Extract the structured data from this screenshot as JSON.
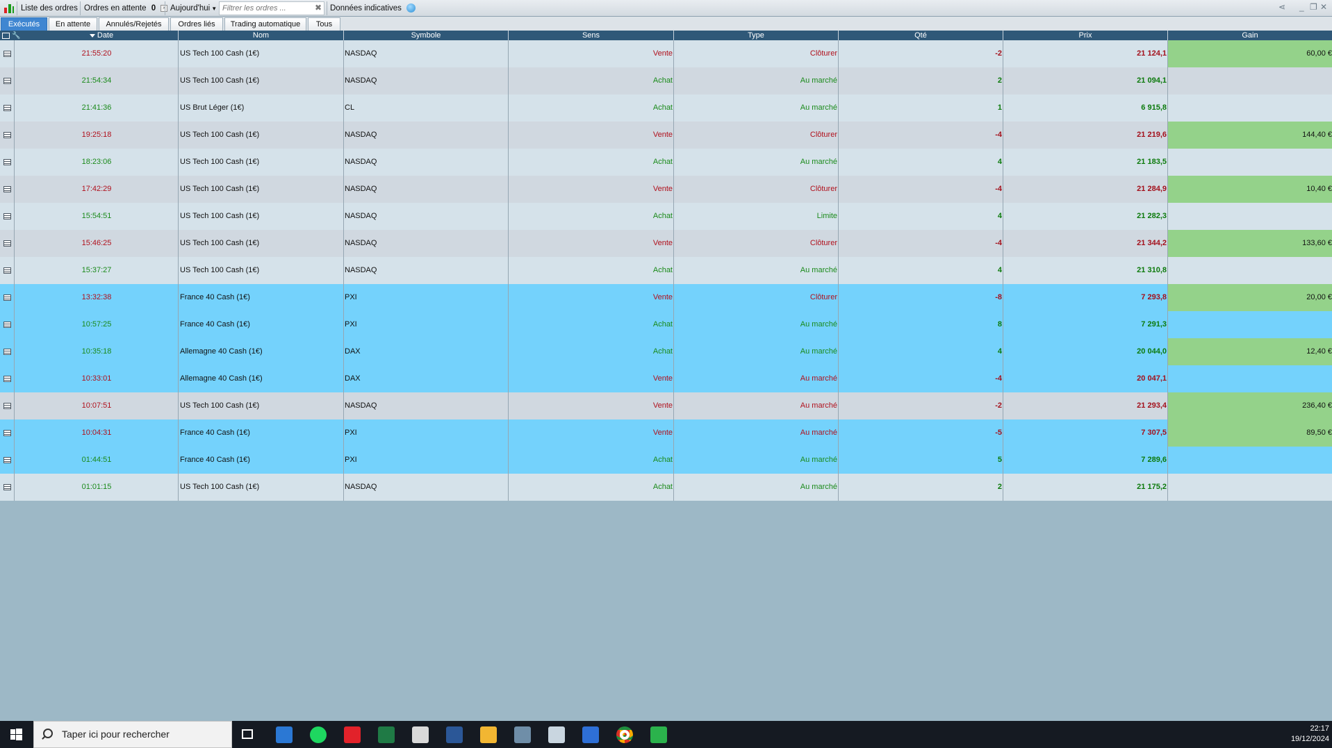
{
  "toolbar": {
    "orders_list": "Liste des ordres",
    "pending_orders": "Ordres en attente",
    "pending_count": "0",
    "period": "Aujourd'hui",
    "filter_placeholder": "Filtrer les ordres ...",
    "indicative_data": "Données indicatives"
  },
  "tabs": [
    "Exécutés",
    "En attente",
    "Annulés/Rejetés",
    "Ordres liés",
    "Trading automatique",
    "Tous"
  ],
  "columns": {
    "date": "Date",
    "nom": "Nom",
    "symbole": "Symbole",
    "sens": "Sens",
    "type": "Type",
    "qte": "Qté",
    "prix": "Prix",
    "gain": "Gain"
  },
  "colors": {
    "buy": "#1a8a1a",
    "sell": "#b0101c",
    "highlight_row": "#74d2fc",
    "gain_bg": "#94d28a",
    "header_bg": "#2f5878",
    "active_tab": "#3f86d1"
  },
  "rows": [
    {
      "date": "21:55:20",
      "nom": "US Tech 100 Cash (1€)",
      "symbole": "NASDAQ",
      "sens": "Vente",
      "type": "Clôturer",
      "qte": "-2",
      "prix": "21 124,1",
      "gain": "60,00 €",
      "side": "sell",
      "hl": false
    },
    {
      "date": "21:54:34",
      "nom": "US Tech 100 Cash (1€)",
      "symbole": "NASDAQ",
      "sens": "Achat",
      "type": "Au marché",
      "qte": "2",
      "prix": "21 094,1",
      "gain": "",
      "side": "buy",
      "hl": false
    },
    {
      "date": "21:41:36",
      "nom": "US Brut Léger (1€)",
      "symbole": "CL",
      "sens": "Achat",
      "type": "Au marché",
      "qte": "1",
      "prix": "6 915,8",
      "gain": "",
      "side": "buy",
      "hl": false
    },
    {
      "date": "19:25:18",
      "nom": "US Tech 100 Cash (1€)",
      "symbole": "NASDAQ",
      "sens": "Vente",
      "type": "Clôturer",
      "qte": "-4",
      "prix": "21 219,6",
      "gain": "144,40 €",
      "side": "sell",
      "hl": false
    },
    {
      "date": "18:23:06",
      "nom": "US Tech 100 Cash (1€)",
      "symbole": "NASDAQ",
      "sens": "Achat",
      "type": "Au marché",
      "qte": "4",
      "prix": "21 183,5",
      "gain": "",
      "side": "buy",
      "hl": false
    },
    {
      "date": "17:42:29",
      "nom": "US Tech 100 Cash (1€)",
      "symbole": "NASDAQ",
      "sens": "Vente",
      "type": "Clôturer",
      "qte": "-4",
      "prix": "21 284,9",
      "gain": "10,40 €",
      "side": "sell",
      "hl": false
    },
    {
      "date": "15:54:51",
      "nom": "US Tech 100 Cash (1€)",
      "symbole": "NASDAQ",
      "sens": "Achat",
      "type": "Limite",
      "qte": "4",
      "prix": "21 282,3",
      "gain": "",
      "side": "buy",
      "hl": false
    },
    {
      "date": "15:46:25",
      "nom": "US Tech 100 Cash (1€)",
      "symbole": "NASDAQ",
      "sens": "Vente",
      "type": "Clôturer",
      "qte": "-4",
      "prix": "21 344,2",
      "gain": "133,60 €",
      "side": "sell",
      "hl": false
    },
    {
      "date": "15:37:27",
      "nom": "US Tech 100 Cash (1€)",
      "symbole": "NASDAQ",
      "sens": "Achat",
      "type": "Au marché",
      "qte": "4",
      "prix": "21 310,8",
      "gain": "",
      "side": "buy",
      "hl": false
    },
    {
      "date": "13:32:38",
      "nom": "France 40 Cash (1€)",
      "symbole": "PXI",
      "sens": "Vente",
      "type": "Clôturer",
      "qte": "-8",
      "prix": "7 293,8",
      "gain": "20,00 €",
      "side": "sell",
      "hl": true
    },
    {
      "date": "10:57:25",
      "nom": "France 40 Cash (1€)",
      "symbole": "PXI",
      "sens": "Achat",
      "type": "Au marché",
      "qte": "8",
      "prix": "7 291,3",
      "gain": "",
      "side": "buy",
      "hl": true
    },
    {
      "date": "10:35:18",
      "nom": "Allemagne 40 Cash (1€)",
      "symbole": "DAX",
      "sens": "Achat",
      "type": "Au marché",
      "qte": "4",
      "prix": "20 044,0",
      "gain": "12,40 €",
      "side": "buy",
      "hl": true
    },
    {
      "date": "10:33:01",
      "nom": "Allemagne 40 Cash (1€)",
      "symbole": "DAX",
      "sens": "Vente",
      "type": "Au marché",
      "qte": "-4",
      "prix": "20 047,1",
      "gain": "",
      "side": "sell",
      "hl": true
    },
    {
      "date": "10:07:51",
      "nom": "US Tech 100 Cash (1€)",
      "symbole": "NASDAQ",
      "sens": "Vente",
      "type": "Au marché",
      "qte": "-2",
      "prix": "21 293,4",
      "gain": "236,40 €",
      "side": "sell",
      "hl": false
    },
    {
      "date": "10:04:31",
      "nom": "France 40 Cash (1€)",
      "symbole": "PXI",
      "sens": "Vente",
      "type": "Au marché",
      "qte": "-5",
      "prix": "7 307,5",
      "gain": "89,50 €",
      "side": "sell",
      "hl": true
    },
    {
      "date": "01:44:51",
      "nom": "France 40 Cash (1€)",
      "symbole": "PXI",
      "sens": "Achat",
      "type": "Au marché",
      "qte": "5",
      "prix": "7 289,6",
      "gain": "",
      "side": "buy",
      "hl": true
    },
    {
      "date": "01:01:15",
      "nom": "US Tech 100 Cash (1€)",
      "symbole": "NASDAQ",
      "sens": "Achat",
      "type": "Au marché",
      "qte": "2",
      "prix": "21 175,2",
      "gain": "",
      "side": "buy",
      "hl": false
    }
  ],
  "taskbar": {
    "search_placeholder": "Taper ici pour rechercher",
    "time": "22:17",
    "date": "19/12/2024",
    "icons": [
      "task-view-icon",
      "app-blue-icon",
      "spotify-icon",
      "ig-icon",
      "excel-icon",
      "scanner-icon",
      "word-icon",
      "file-explorer-icon",
      "calculator-icon",
      "paint-icon",
      "app-arrow-icon",
      "chrome-icon",
      "trading-chart-icon"
    ]
  }
}
